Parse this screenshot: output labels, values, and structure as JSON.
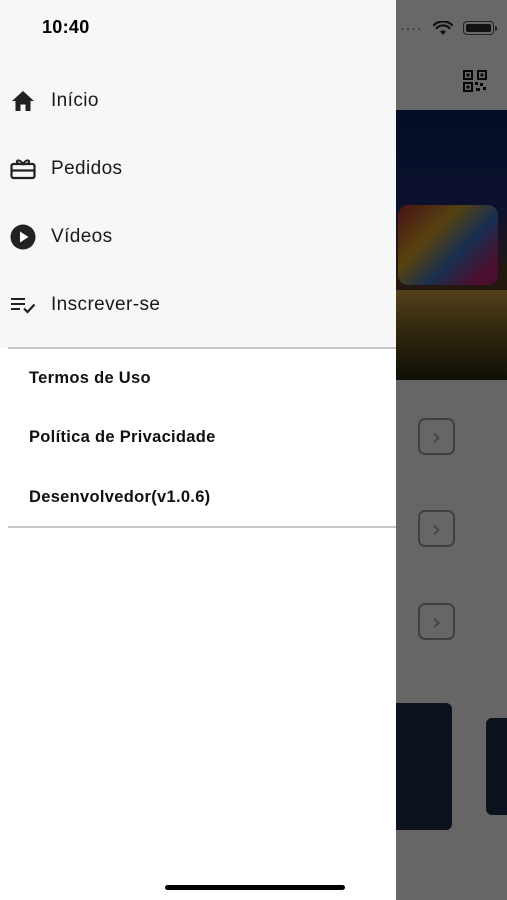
{
  "status_bar": {
    "time": "10:40",
    "signal": "····"
  },
  "drawer": {
    "nav": [
      {
        "label": "Início",
        "icon": "home-icon"
      },
      {
        "label": "Pedidos",
        "icon": "gift-card-icon"
      },
      {
        "label": "Vídeos",
        "icon": "play-circle-icon"
      },
      {
        "label": "Inscrever-se",
        "icon": "playlist-check-icon"
      }
    ],
    "links": [
      {
        "label": "Termos de Uso"
      },
      {
        "label": "Política de Privacidade"
      },
      {
        "label": "Desenvolvedor(v1.0.6)"
      }
    ]
  },
  "background": {
    "arrow_glyph": "›",
    "icons": [
      "qr-code-icon"
    ]
  },
  "colors": {
    "drawer_bg": "#ffffff",
    "drawer_top_bg": "#f7f7f7",
    "text": "#1a1a1a",
    "divider": "#c6c6c6",
    "scrim": "rgba(0,0,0,0.58)"
  }
}
